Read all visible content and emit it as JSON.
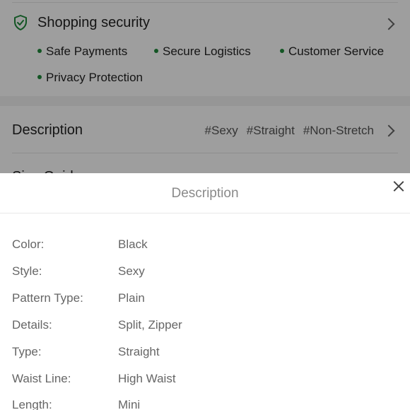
{
  "shopping_security": {
    "title": "Shopping security",
    "features": [
      "Safe Payments",
      "Secure Logistics",
      "Customer Service",
      "Privacy Protection"
    ]
  },
  "description_row": {
    "title": "Description",
    "tags": [
      "#Sexy",
      "#Straight",
      "#Non-Stretch"
    ]
  },
  "size_guide": {
    "title": "Size Guide"
  },
  "sheet": {
    "title": "Description",
    "attributes": [
      {
        "label": "Color:",
        "value": "Black"
      },
      {
        "label": "Style:",
        "value": "Sexy"
      },
      {
        "label": "Pattern Type:",
        "value": "Plain"
      },
      {
        "label": "Details:",
        "value": "Split, Zipper"
      },
      {
        "label": "Type:",
        "value": "Straight"
      },
      {
        "label": "Waist Line:",
        "value": "High Waist"
      },
      {
        "label": "Length:",
        "value": "Mini"
      }
    ]
  },
  "colors": {
    "accent_green": "#1f8a3b"
  }
}
